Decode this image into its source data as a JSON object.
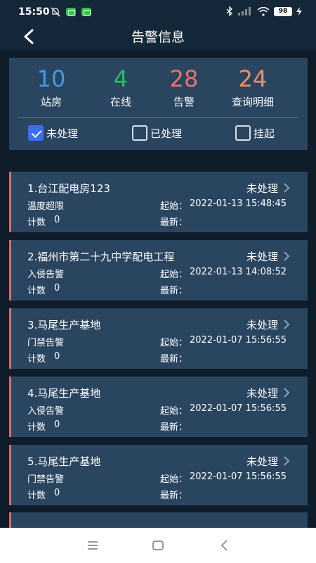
{
  "status_bar": {
    "time": "15:50",
    "battery": "98"
  },
  "header": {
    "title": "告警信息"
  },
  "summary": {
    "stats": [
      {
        "value": "10",
        "label": "站房",
        "color": "#3e9bea"
      },
      {
        "value": "4",
        "label": "在线",
        "color": "#21c25c"
      },
      {
        "value": "28",
        "label": "告警",
        "color": "#e8726a"
      },
      {
        "value": "24",
        "label": "查询明细",
        "color": "#ee8f63"
      }
    ],
    "filters": [
      {
        "label": "未处理",
        "checked": true
      },
      {
        "label": "已处理",
        "checked": false
      },
      {
        "label": "挂起",
        "checked": false
      }
    ]
  },
  "alarms": [
    {
      "title": "1.台江配电房123",
      "status": "未处理",
      "type": "温度超限",
      "start_label": "起始：",
      "start": "2022-01-13 15:48:45",
      "count_label": "计数",
      "count": "0",
      "latest_label": "最新："
    },
    {
      "title": "2.福州市第二十九中学配电工程",
      "status": "未处理",
      "type": "入侵告警",
      "start_label": "起始：",
      "start": "2022-01-13 14:08:52",
      "count_label": "计数",
      "count": "0",
      "latest_label": "最新："
    },
    {
      "title": "3.马尾生产基地",
      "status": "未处理",
      "type": "门禁告警",
      "start_label": "起始：",
      "start": "2022-01-07 15:56:55",
      "count_label": "计数",
      "count": "0",
      "latest_label": "最新："
    },
    {
      "title": "4.马尾生产基地",
      "status": "未处理",
      "type": "入侵告警",
      "start_label": "起始：",
      "start": "2022-01-07 15:56:55",
      "count_label": "计数",
      "count": "0",
      "latest_label": "最新："
    },
    {
      "title": "5.马尾生产基地",
      "status": "未处理",
      "type": "门禁告警",
      "start_label": "起始：",
      "start": "2022-01-07 15:56:55",
      "count_label": "计数",
      "count": "0",
      "latest_label": "最新："
    }
  ],
  "icons": {
    "back": "chevron-left-icon",
    "card_chevron": "chevron-right-icon",
    "nav": [
      "menu-icon",
      "home-square-icon",
      "back-triangle-icon"
    ]
  }
}
